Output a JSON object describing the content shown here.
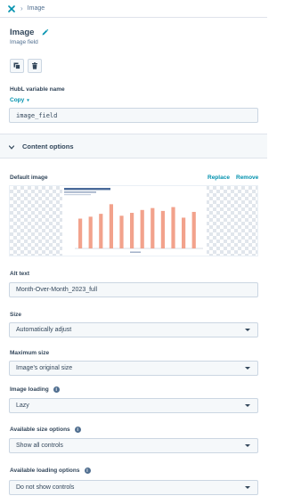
{
  "breadcrumb": {
    "close_icon": "close-icon",
    "current": "Image"
  },
  "field": {
    "title": "Image",
    "subtitle": "Image field"
  },
  "toolbar": {
    "clone_icon": "clone-icon",
    "delete_icon": "trash-icon"
  },
  "hubl": {
    "label": "HubL variable name",
    "copy_label": "Copy",
    "value": "image_field"
  },
  "content_options": {
    "title": "Content options"
  },
  "default_image": {
    "label": "Default image",
    "replace_label": "Replace",
    "remove_label": "Remove"
  },
  "alt_text": {
    "label": "Alt text",
    "value": "Month-Over-Month_2023_full"
  },
  "size": {
    "label": "Size",
    "value": "Automatically adjust"
  },
  "max_size": {
    "label": "Maximum size",
    "value": "Image's original size"
  },
  "loading": {
    "label": "Image loading",
    "value": "Lazy"
  },
  "size_options": {
    "label": "Available size options",
    "value": "Show all controls"
  },
  "loading_options": {
    "label": "Available loading options",
    "value": "Do not show controls"
  },
  "colors": {
    "link": "#0091ae",
    "text": "#33475b",
    "bar": "#f2a28c"
  }
}
